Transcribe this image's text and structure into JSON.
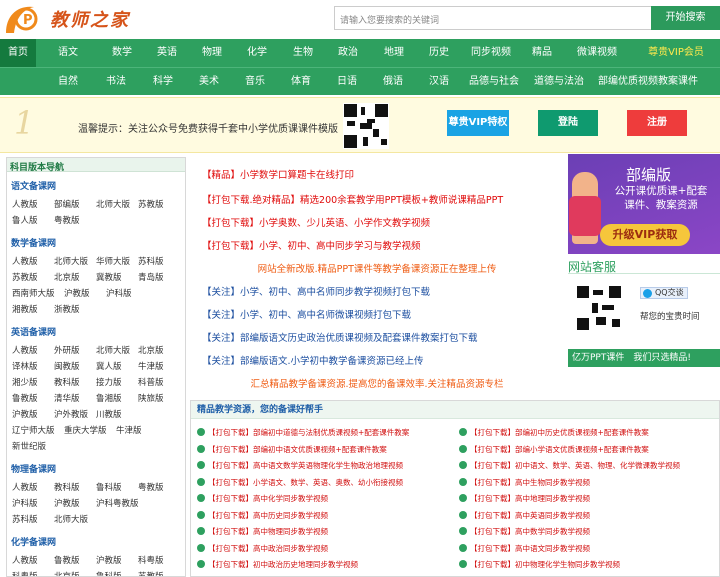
{
  "header": {
    "logo_text": "教师之家",
    "search_placeholder": "请输入您要搜索的关键词",
    "search_button": "开始搜索"
  },
  "nav1": [
    "首页",
    "语文",
    "数学",
    "英语",
    "物理",
    "化学",
    "生物",
    "政治",
    "地理",
    "历史",
    "同步视频",
    "精品",
    "微课视频",
    "尊贵VIP会员"
  ],
  "nav2": [
    "自然",
    "书法",
    "科学",
    "美术",
    "音乐",
    "体育",
    "日语",
    "俄语",
    "汉语",
    "品德与社会",
    "道德与法治",
    "部编优质视频教案课件"
  ],
  "banner": {
    "num": "1",
    "tip": "温馨提示：关注公众号免费获得千套中小学优质课课件模版",
    "vip": "尊贵VIP特权",
    "login": "登陆",
    "register": "注册"
  },
  "left": {
    "header": "科目版本导航",
    "sections": [
      {
        "title": "语文备课网",
        "items": [
          "人教版",
          "部编版",
          "北师大版",
          "苏教版",
          "鲁人版",
          "粤教版"
        ]
      },
      {
        "title": "数学备课网",
        "items": [
          "人教版",
          "北师大版",
          "华师大版",
          "苏科版",
          "苏教版",
          "北京版",
          "冀教版",
          "青岛版",
          "西南师大版",
          "沪教版",
          "沪科版",
          "湘教版",
          "浙教版"
        ]
      },
      {
        "title": "英语备课网",
        "items": [
          "人教版",
          "外研版",
          "北师大版",
          "北京版",
          "译林版",
          "闽教版",
          "冀人版",
          "牛津版",
          "湘少版",
          "教科版",
          "接力版",
          "科普版",
          "鲁教版",
          "清华版",
          "鲁湘版",
          "陕旅版",
          "沪教版",
          "沪外教版",
          "川教版",
          "辽宁师大版",
          "重庆大学版",
          "牛津版",
          "新世纪版"
        ]
      },
      {
        "title": "物理备课网",
        "items": [
          "人教版",
          "教科版",
          "鲁科版",
          "粤教版",
          "沪科版",
          "沪教版",
          "沪科粤教版",
          "苏科版",
          "北师大版"
        ]
      },
      {
        "title": "化学备课网",
        "items": [
          "人教版",
          "鲁教版",
          "沪教版",
          "科粤版",
          "科粤版",
          "北京版",
          "鲁科版",
          "苏教版"
        ]
      }
    ]
  },
  "center": [
    {
      "text": "【精品】小学数学口算题卡在线打印",
      "style": "red"
    },
    {
      "text": "【打包下载.绝对精品】精选200余套教学用PPT模板+教师说课精品PPT",
      "style": "red"
    },
    {
      "text": "【打包下载】小学奥数、少儿英语、小学作文教学视频",
      "style": "red"
    },
    {
      "text": "【打包下载】小学、初中、高中同步学习与教学视频",
      "style": "red"
    },
    {
      "text": "网站全新改版.精品PPT课件等教学备课资源正在整理上传",
      "style": "orange"
    },
    {
      "text": "【关注】小学、初中、高中名师同步教学视频打包下载",
      "style": "blue"
    },
    {
      "text": "【关注】小学、初中、高中名师微课视频打包下载",
      "style": "blue"
    },
    {
      "text": "【关注】部编版语文历史政治优质课视频及配套课件教案打包下载",
      "style": "blue"
    },
    {
      "text": "【关注】部编版语文.小学初中教学备课资源已经上传",
      "style": "blue"
    },
    {
      "text": "汇总精品教学备课资源.提高您的备课效率.关注精品资源专栏",
      "style": "orange"
    }
  ],
  "right": {
    "ad_title": "部编版",
    "ad_line1": "公开课优质课+配套",
    "ad_line2": "课件、教案资源",
    "ad_button": "升级VIP获取",
    "service_title": "网站客服",
    "qq": "QQ交谈",
    "assistant": "帮您的宝贵时间",
    "slogan": "亿万PPT课件　我们只选精品!"
  },
  "bottom": {
    "header": "精品教学资源，您的备课好帮手",
    "left_items": [
      "【打包下载】部编初中道德与法制优质课视频+配套课件教案",
      "【打包下载】部编初中语文优质课视频+配套课件教案",
      "【打包下载】高中语文数学英语物理化学生物政治地理视频",
      "【打包下载】小学语文、数学、英语、奥数、幼小衔接视频",
      "【打包下载】高中化学同步教学视频",
      "【打包下载】高中历史同步教学视频",
      "【打包下载】高中物理同步教学视频",
      "【打包下载】高中政治同步教学视频",
      "【打包下载】初中政治历史地理同步教学视频"
    ],
    "right_items": [
      "【打包下载】部编初中历史优质课视频+配套课件教案",
      "【打包下载】部编小学语文优质课视频+配套课件教案",
      "【打包下载】初中语文、数学、英语、物理、化学微课教学视频",
      "【打包下载】高中生物同步教学视频",
      "【打包下载】高中地理同步教学视频",
      "【打包下载】高中英语同步教学视频",
      "【打包下载】高中数学同步教学视频",
      "【打包下载】高中语文同步教学视频",
      "【打包下载】初中物理化学生物同步教学视频"
    ]
  }
}
